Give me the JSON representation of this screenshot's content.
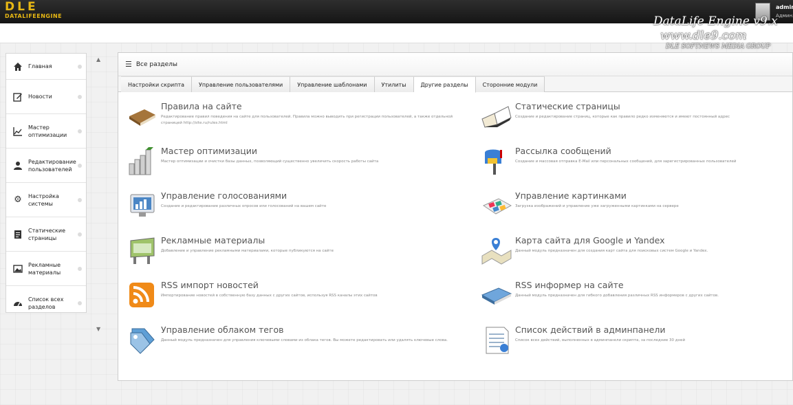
{
  "header": {
    "logo_main": "DLE",
    "logo_sub": "DATALIFEENGINE",
    "user_name": "admin",
    "user_role": "Админ..."
  },
  "watermark": {
    "line1": "DataLife Engine v9.x",
    "line2": "www.dle9.com",
    "line3": "DLE SOFTNEWS MEDIA GROUP"
  },
  "sidebar": {
    "items": [
      {
        "label": "Главная",
        "icon": "home-icon"
      },
      {
        "label": "Новости",
        "icon": "edit-icon"
      },
      {
        "label": "Мастер оптимизации",
        "icon": "chart-icon"
      },
      {
        "label": "Редактирование пользователей",
        "icon": "user-icon"
      },
      {
        "label": "Настройка системы",
        "icon": "gear-icon"
      },
      {
        "label": "Статические страницы",
        "icon": "page-icon"
      },
      {
        "label": "Рекламные материалы",
        "icon": "image-icon"
      },
      {
        "label": "Список всех разделов",
        "icon": "dashboard-icon"
      }
    ]
  },
  "main": {
    "title": "Все разделы",
    "tabs": [
      "Настройки скрипта",
      "Управление пользователями",
      "Управление шаблонами",
      "Утилиты",
      "Другие разделы",
      "Сторонние модули"
    ],
    "active_tab": "Другие разделы",
    "modules": [
      {
        "title": "Правила на сайте",
        "desc": "Редактирование правил поведения на сайте для пользователей. Правила можно выводить при регистрации пользователей, а также отдельной страницей http://site.ru/rules.html",
        "icon": "book-icon"
      },
      {
        "title": "Статические страницы",
        "desc": "Создание и редактирование страниц, которые как правило редко изменяются и имеют постоянный адрес",
        "icon": "open-book-icon"
      },
      {
        "title": "Мастер оптимизации",
        "desc": "Мастер оптимизации и очистки базы данных, позволяющий существенно увеличить скорость работы сайта",
        "icon": "bars-icon"
      },
      {
        "title": "Рассылка сообщений",
        "desc": "Создание и массовая отправка E-Mail или персональных сообщений, для зарегистрированных пользователей",
        "icon": "mailbox-icon"
      },
      {
        "title": "Управление голосованиями",
        "desc": "Создание и редактирование различных опросов или голосований на вашем сайте",
        "icon": "monitor-chart-icon"
      },
      {
        "title": "Управление картинками",
        "desc": "Загрузка изображений и управление уже загруженными картинками на сервере",
        "icon": "photos-icon"
      },
      {
        "title": "Рекламные материалы",
        "desc": "Добавление и управление рекламными материалами, которые публикуются на сайте",
        "icon": "billboard-icon"
      },
      {
        "title": "Карта сайта для Google и Yandex",
        "desc": "Данный модуль предназначен для создания карт сайта для поисковых систем Google и Yandex.",
        "icon": "map-icon"
      },
      {
        "title": "RSS импорт новостей",
        "desc": "Импортирование новостей в собственную базу данных с других сайтов, используя RSS каналы этих сайтов",
        "icon": "rss-icon"
      },
      {
        "title": "RSS информер на сайте",
        "desc": "Данный модуль предназначен для гибкого добавления различных RSS информеров с других сайтов.",
        "icon": "notebook-icon"
      },
      {
        "title": "Управление облаком тегов",
        "desc": "Данный модуль предназначен для управления ключевыми словами из облака тегов. Вы можете редактировать или удалять ключевые слова.",
        "icon": "tags-icon"
      },
      {
        "title": "Список действий в админпанели",
        "desc": "Список всех действий, выполненных в админпанели скрипта, за последние 30 дней",
        "icon": "log-icon"
      }
    ]
  },
  "colors": {
    "accent": "#e7b714",
    "topbar": "#1e1e1e"
  }
}
